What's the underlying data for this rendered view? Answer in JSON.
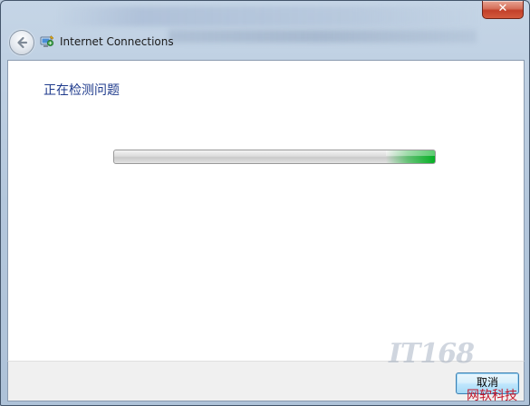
{
  "window": {
    "close_label": "✕"
  },
  "navbar": {
    "title": "Internet Connections",
    "back_icon": "back-arrow-icon",
    "app_icon": "network-troubleshooter-icon"
  },
  "main": {
    "heading": "正在检测问题",
    "progress": {
      "state": "indeterminate",
      "accent_color": "#06b025"
    }
  },
  "footer": {
    "cancel_label": "取消"
  },
  "watermark": {
    "logo": "IT168",
    "text": "网软科技"
  }
}
